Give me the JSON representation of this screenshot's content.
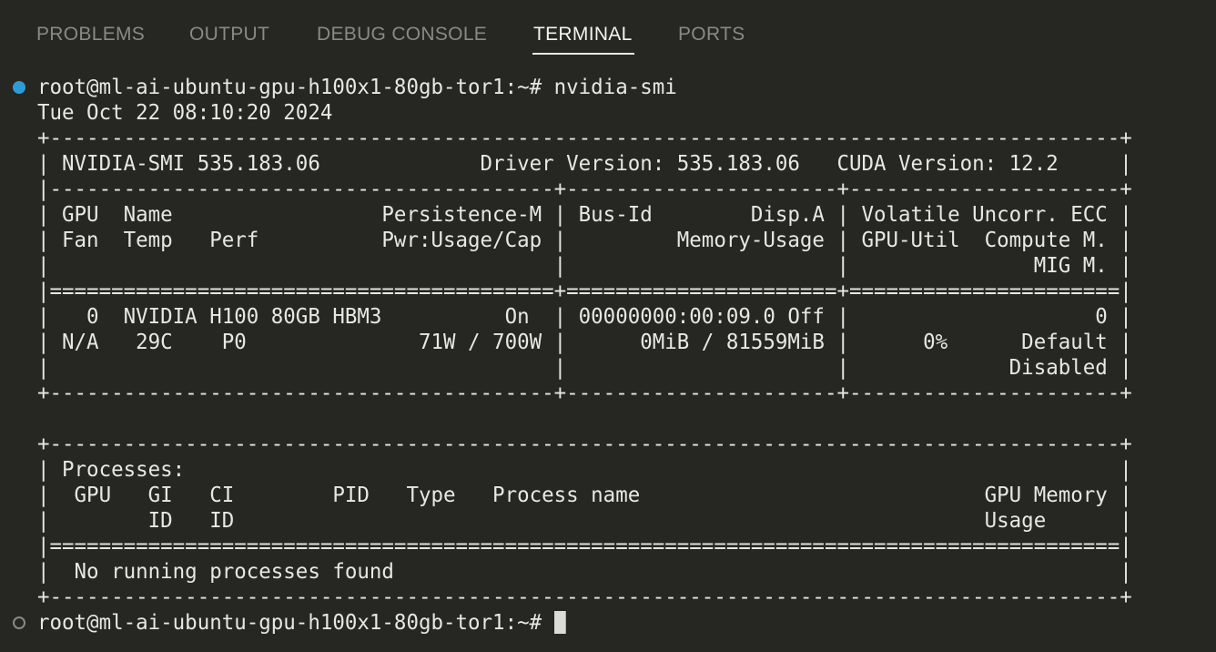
{
  "tabs": [
    {
      "label": "PROBLEMS",
      "active": false
    },
    {
      "label": "OUTPUT",
      "active": false
    },
    {
      "label": "DEBUG CONSOLE",
      "active": false
    },
    {
      "label": "TERMINAL",
      "active": true
    },
    {
      "label": "PORTS",
      "active": false
    }
  ],
  "colors": {
    "background": "#262622",
    "text": "#e8e8e2",
    "tab_inactive": "#8a8a84",
    "success_dot": "#2f9bd6"
  },
  "terminal": {
    "command_line": "root@ml-ai-ubuntu-gpu-h100x1-80gb-tor1:~# nvidia-smi",
    "output": [
      "Tue Oct 22 08:10:20 2024",
      "+---------------------------------------------------------------------------------------+",
      "| NVIDIA-SMI 535.183.06             Driver Version: 535.183.06   CUDA Version: 12.2     |",
      "|-----------------------------------------+----------------------+----------------------+",
      "| GPU  Name                 Persistence-M | Bus-Id        Disp.A | Volatile Uncorr. ECC |",
      "| Fan  Temp   Perf          Pwr:Usage/Cap |         Memory-Usage | GPU-Util  Compute M. |",
      "|                                         |                      |               MIG M. |",
      "|=========================================+======================+======================|",
      "|   0  NVIDIA H100 80GB HBM3          On  | 00000000:00:09.0 Off |                    0 |",
      "| N/A   29C    P0              71W / 700W |      0MiB / 81559MiB |      0%      Default |",
      "|                                         |                      |             Disabled |",
      "+-----------------------------------------+----------------------+----------------------+",
      "",
      "+---------------------------------------------------------------------------------------+",
      "| Processes:                                                                            |",
      "|  GPU   GI   CI        PID   Type   Process name                            GPU Memory |",
      "|        ID   ID                                                             Usage      |",
      "|=======================================================================================|",
      "|  No running processes found                                                           |",
      "+---------------------------------------------------------------------------------------+"
    ],
    "prompt": "root@ml-ai-ubuntu-gpu-h100x1-80gb-tor1:~# "
  }
}
